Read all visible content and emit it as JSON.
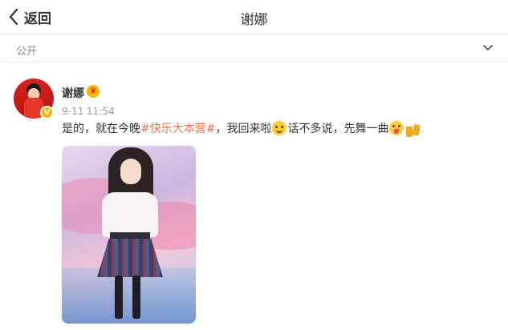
{
  "nav": {
    "back_label": "返回",
    "title": "谢娜"
  },
  "visibility": {
    "label": "公开"
  },
  "post": {
    "author": "谢娜",
    "time": "9-11 11:54",
    "text_part1": "是的，就在今晚",
    "hashtag": "#快乐大本营#",
    "text_part2": "，我回来啦",
    "text_part3": "话不多说，先舞一曲",
    "emojis": [
      "smile-emoji",
      "tongue-emoji",
      "cheers-emoji"
    ],
    "verified_badge": "V",
    "accent_color": "#eb7350"
  }
}
